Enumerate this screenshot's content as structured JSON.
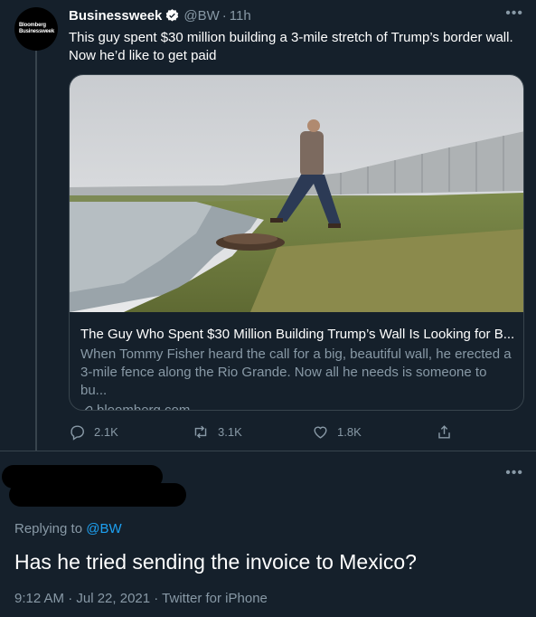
{
  "tweet": {
    "avatar_text": [
      "Bloomberg",
      "Businessweek"
    ],
    "display_name": "Businessweek",
    "handle": "@BW",
    "separator": "·",
    "time_ago": "11h",
    "more_icon": "more-icon",
    "text": "This guy spent $30 million building a 3-mile stretch of Trump’s border wall. Now he’d like to get paid",
    "card": {
      "title": "The Guy Who Spent $30 Million Building Trump’s Wall Is Looking for B...",
      "description": "When Tommy Fisher heard the call for a big, beautiful wall, he erected a 3-mile fence along the Rio Grande. Now all he needs is someone to bu...",
      "domain": "bloomberg.com"
    },
    "actions": {
      "reply_count": "2.1K",
      "retweet_count": "3.1K",
      "like_count": "1.8K"
    }
  },
  "reply": {
    "replying_prefix": "Replying to",
    "replying_handle": "@BW",
    "text": "Has he tried sending the invoice to Mexico?",
    "meta": "9:12 AM · Jul 22, 2021 · Twitter for iPhone"
  },
  "colors": {
    "background": "#15202b",
    "secondary_text": "#8899a6",
    "accent": "#1da1f2",
    "border": "#38444d"
  }
}
